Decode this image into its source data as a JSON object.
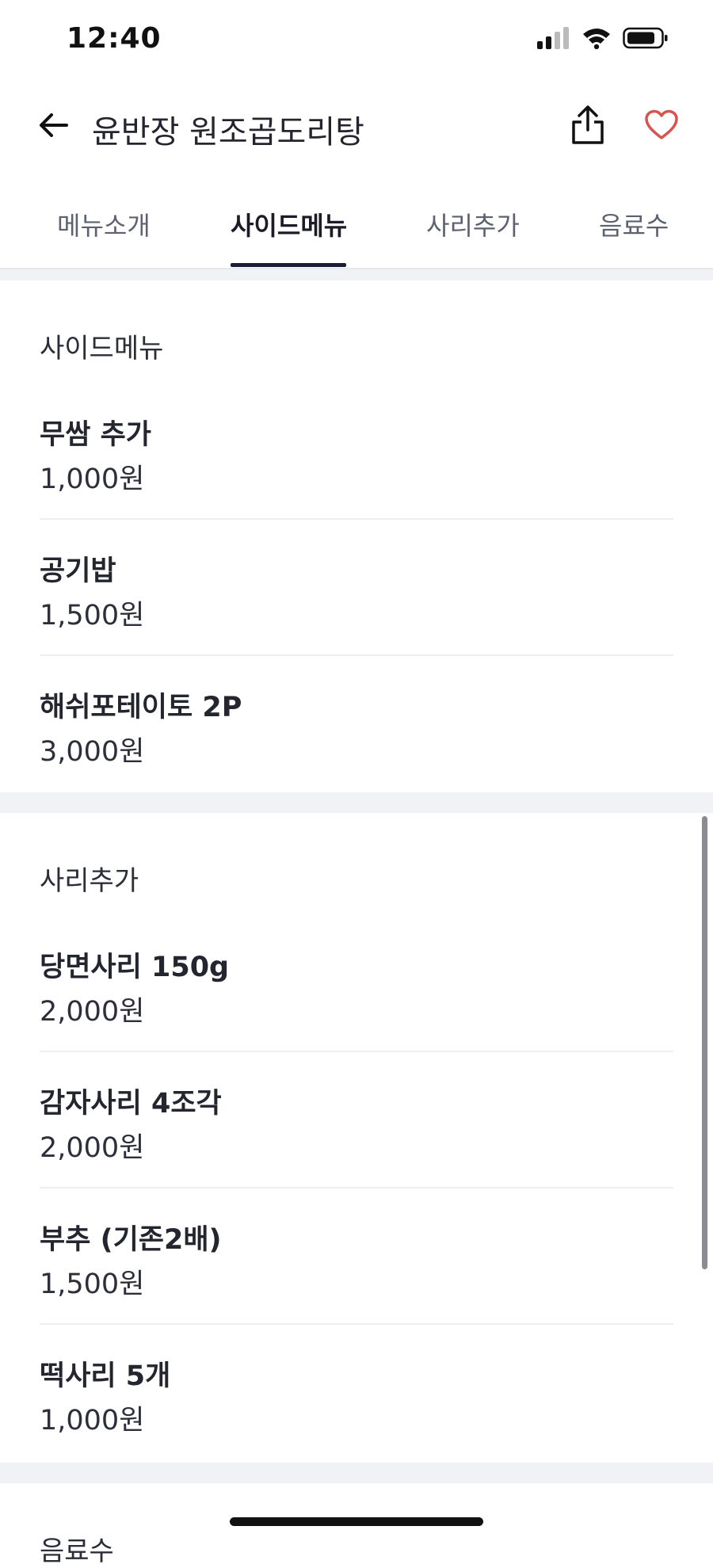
{
  "status_bar": {
    "time": "12:40",
    "icons": [
      "cellular-signal-icon",
      "wifi-icon",
      "battery-icon"
    ]
  },
  "header": {
    "title": "윤반장 원조곱도리탕",
    "icons": [
      "back-arrow-icon",
      "share-icon",
      "heart-icon"
    ],
    "accent_color": "#d9534f"
  },
  "tabs": [
    {
      "label": "메뉴소개",
      "active": false
    },
    {
      "label": "사이드메뉴",
      "active": true
    },
    {
      "label": "사리추가",
      "active": false
    },
    {
      "label": "음료수",
      "active": false
    }
  ],
  "sections": [
    {
      "title": "사이드메뉴",
      "items": [
        {
          "name": "무쌈 추가",
          "price": "1,000원"
        },
        {
          "name": "공기밥",
          "price": "1,500원"
        },
        {
          "name": "해쉬포테이토 2P",
          "price": "3,000원"
        }
      ]
    },
    {
      "title": "사리추가",
      "items": [
        {
          "name": "당면사리 150g",
          "price": "2,000원"
        },
        {
          "name": "감자사리 4조각",
          "price": "2,000원"
        },
        {
          "name": "부추 (기존2배)",
          "price": "1,500원"
        },
        {
          "name": "떡사리 5개",
          "price": "1,000원"
        }
      ]
    },
    {
      "title": "음료수",
      "items": []
    }
  ]
}
